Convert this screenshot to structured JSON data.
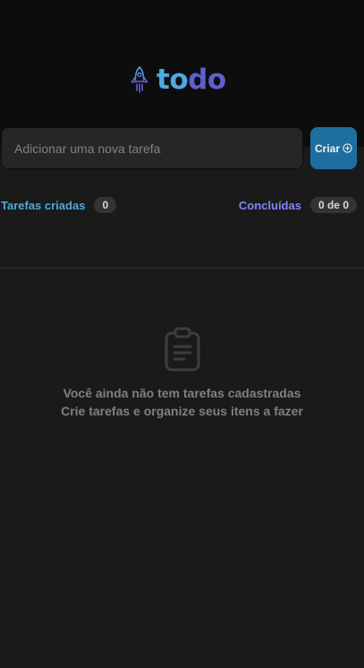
{
  "brand": {
    "part1": "to",
    "part2": "do",
    "icon": "rocket-icon"
  },
  "form": {
    "placeholder": "Adicionar uma nova tarefa",
    "create_label": "Criar",
    "create_icon": "plus-circle-icon"
  },
  "summary": {
    "created_label": "Tarefas criadas",
    "created_count": "0",
    "done_label": "Concluídas",
    "done_count": "0 de 0"
  },
  "empty_state": {
    "icon": "clipboard-icon",
    "title": "Você ainda não tem tarefas cadastradas",
    "subtitle": "Crie tarefas e organize seus itens a fazer"
  },
  "colors": {
    "blue": "#4ea8de",
    "purple": "#5e60ce",
    "purple_light": "#8284fa",
    "blue_dark": "#1e6f9f",
    "background": "#1a1a1a",
    "header": "#0d0d0d"
  }
}
